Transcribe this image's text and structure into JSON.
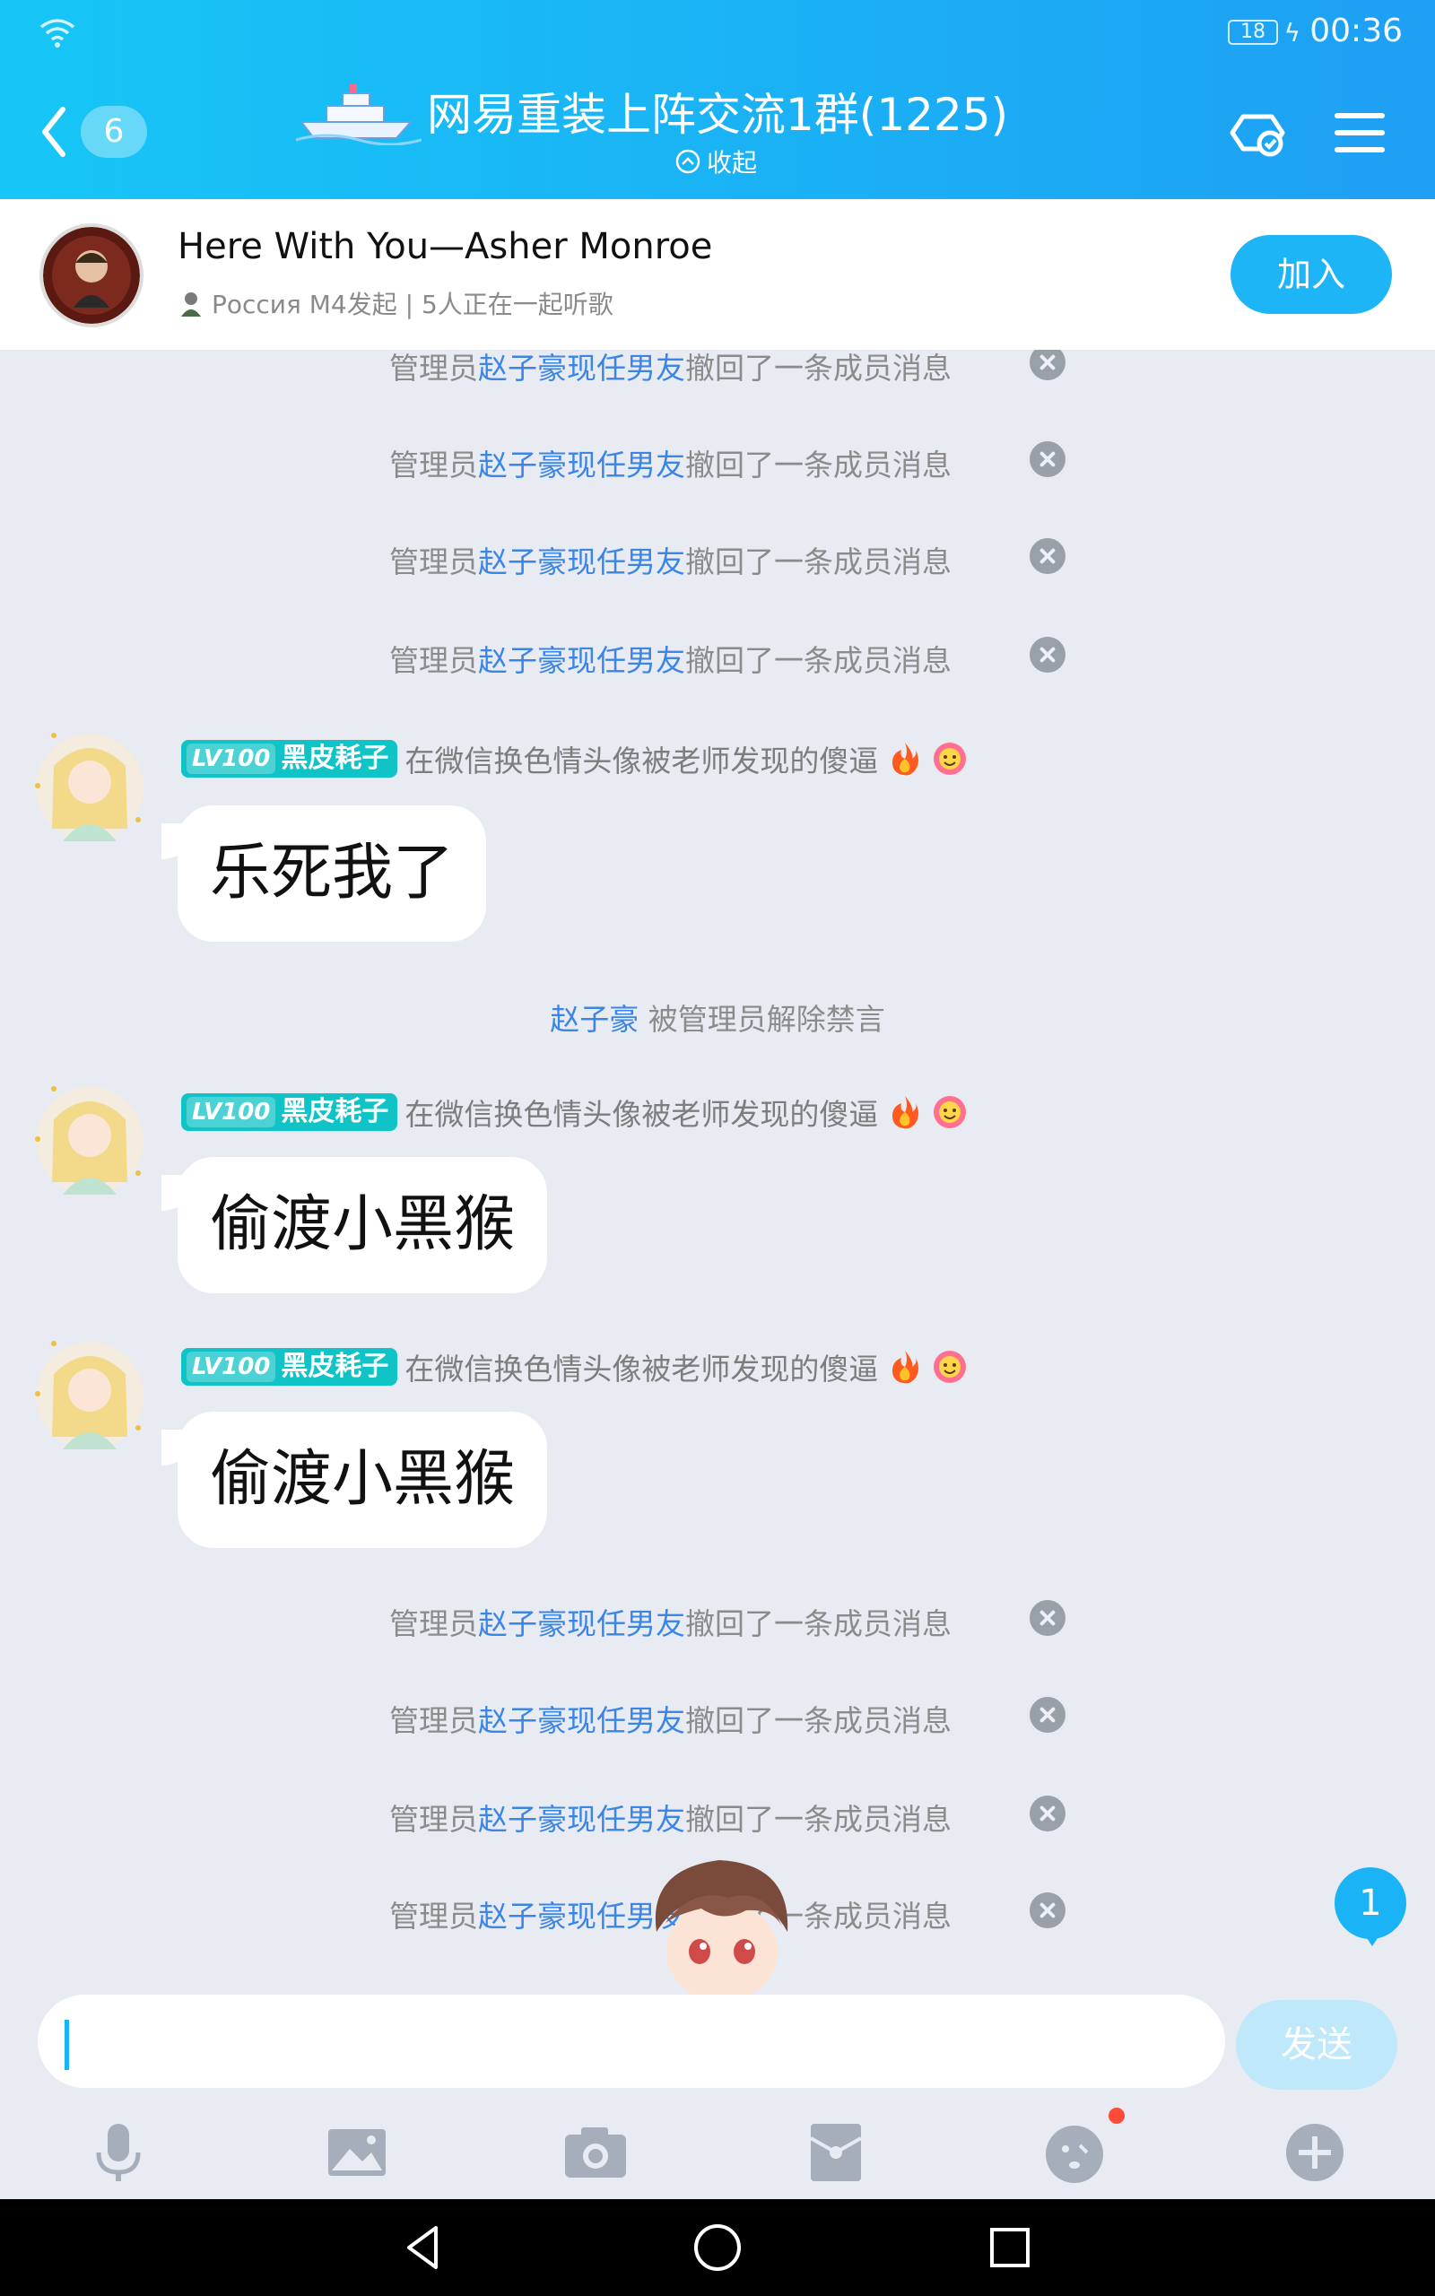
{
  "status": {
    "battery": "18",
    "time": "00:36"
  },
  "header": {
    "unread_count": "6",
    "title": "网易重装上阵交流1群(1225)",
    "collapse_label": "收起"
  },
  "banner": {
    "song": "Here With You—Asher Monroe",
    "sub": "Россия М4发起 | 5人正在一起听歌",
    "join_label": "加入"
  },
  "recall_notice": {
    "prefix": "管理员",
    "link": "赵子豪现任男友",
    "suffix": "撤回了一条成员消息"
  },
  "messages": [
    {
      "level": "LV100",
      "title": "黑皮耗子",
      "nick": "在微信换色情头像被老师发现的傻逼",
      "text": "乐死我了"
    },
    {
      "level": "LV100",
      "title": "黑皮耗子",
      "nick": "在微信换色情头像被老师发现的傻逼",
      "text": "偷渡小黑猴"
    },
    {
      "level": "LV100",
      "title": "黑皮耗子",
      "nick": "在微信换色情头像被老师发现的傻逼",
      "text": "偷渡小黑猴"
    }
  ],
  "unmute": {
    "name": "赵子豪",
    "text": "被管理员解除禁言"
  },
  "float_unread": "1",
  "input": {
    "value": "",
    "placeholder": "",
    "send_label": "发送"
  },
  "colors": {
    "header_start": "#17c6f6",
    "header_end": "#1e9ff4",
    "link": "#3b85e5",
    "level_badge": "#10c3c7"
  }
}
